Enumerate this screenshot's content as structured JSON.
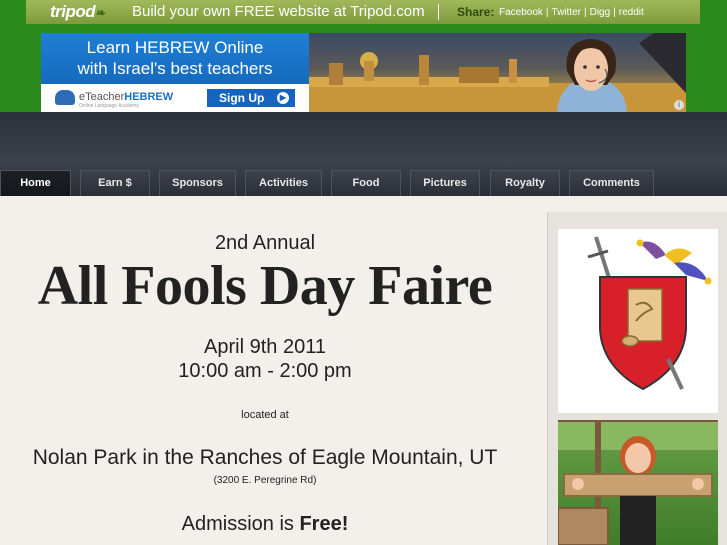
{
  "tripod_bar": {
    "logo": "tripod",
    "tagline": "Build your own FREE website at Tripod.com",
    "share_label": "Share:",
    "share_links": [
      "Facebook",
      "Twitter",
      "Digg",
      "reddit"
    ]
  },
  "ad": {
    "headline_1": "Learn HEBREW Online",
    "headline_2": "with Israel's best teachers",
    "brand_prefix": "eTeacher",
    "brand_suffix": "HEBREW",
    "brand_sub": "Online Language Academy",
    "signup": "Sign Up",
    "info_icon": "i"
  },
  "nav": {
    "tabs": [
      "Home",
      "Earn $",
      "Sponsors",
      "Activities",
      "Food",
      "Pictures",
      "Royalty",
      "Comments"
    ],
    "active": "Home"
  },
  "main": {
    "subtitle": "2nd Annual",
    "title": "All Fools Day Faire",
    "date": "April 9th 2011",
    "time": "10:00 am - 2:00 pm",
    "located": "located at",
    "venue": "Nolan Park in the Ranches of Eagle Mountain, UT",
    "address": "(3200 E. Peregrine Rd)",
    "admission_prefix": "Admission is ",
    "admission_value": "Free!"
  },
  "colors": {
    "page_bg": "#2a8a1c",
    "content_bg": "#f3f0eb",
    "nav_bg": "#2c3038",
    "ad_blue": "#1565c0"
  }
}
